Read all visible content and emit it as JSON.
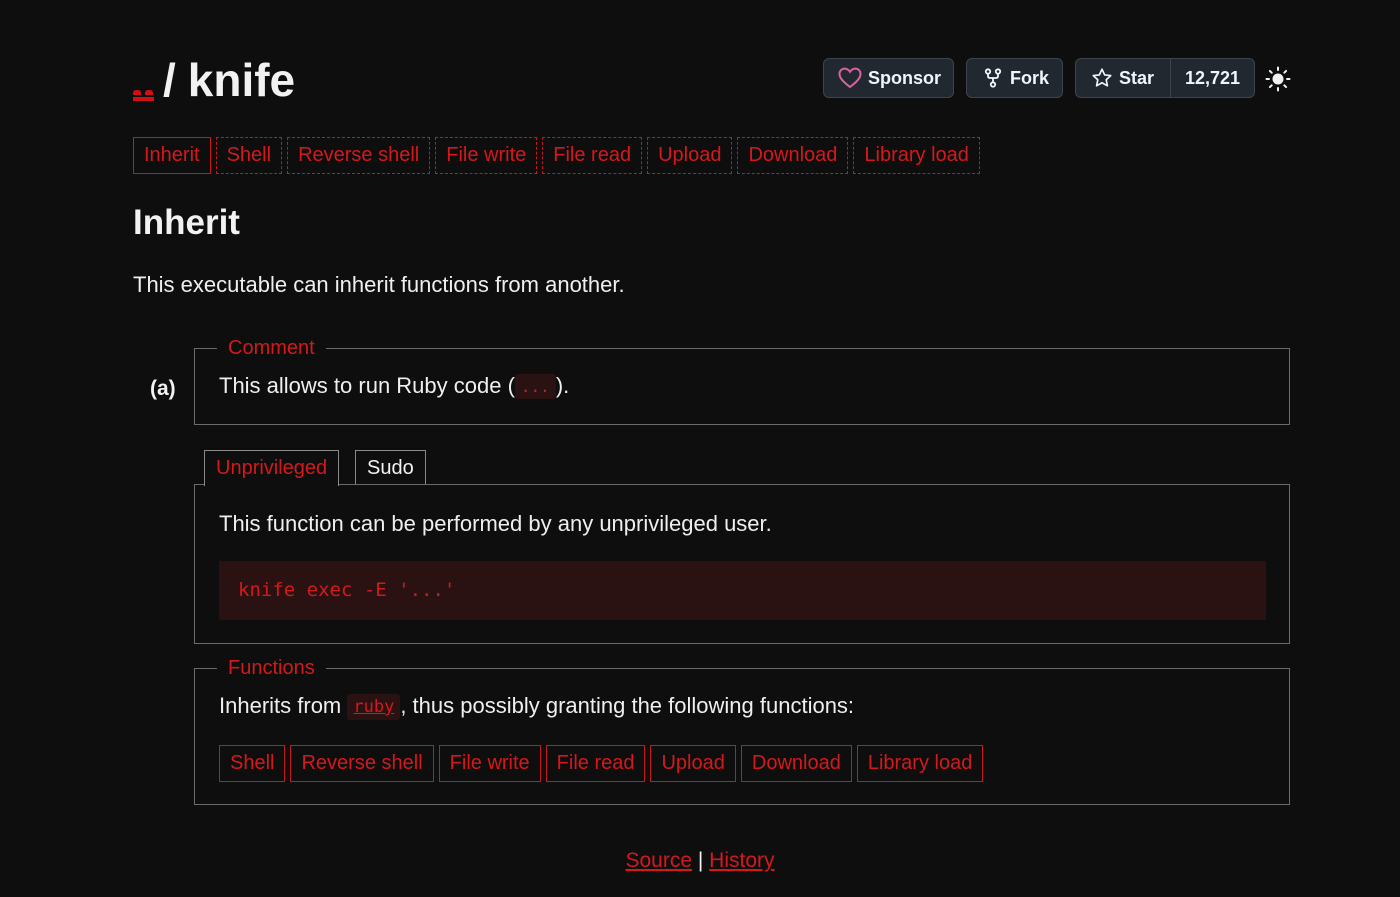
{
  "header": {
    "separator": "/",
    "name": "knife",
    "sponsor_label": "Sponsor",
    "fork_label": "Fork",
    "star_label": "Star",
    "star_count": "12,721"
  },
  "nav_tags": [
    "Inherit",
    "Shell",
    "Reverse shell",
    "File write",
    "File read",
    "Upload",
    "Download",
    "Library load"
  ],
  "section": {
    "title": "Inherit",
    "description": "This executable can inherit functions from another."
  },
  "entry": {
    "label": "(a)",
    "comment_legend": "Comment",
    "comment_text_before": "This allows to run Ruby code (",
    "comment_code": "...",
    "comment_text_after": ").",
    "tabs": [
      "Unprivileged",
      "Sudo"
    ],
    "active_tab": "Unprivileged",
    "privilege_text": "This function can be performed by any unprivileged user.",
    "command": "knife exec -E '...'",
    "functions_legend": "Functions",
    "functions_text_before": "Inherits from ",
    "functions_link": "ruby",
    "functions_text_after": ", thus possibly granting the following functions:",
    "function_tags": [
      "Shell",
      "Reverse shell",
      "File write",
      "File read",
      "Upload",
      "Download",
      "Library load"
    ]
  },
  "footer": {
    "source_label": "Source",
    "separator": "|",
    "history_label": "History"
  },
  "colors": {
    "background": "#0e0e0f",
    "accent": "#d4191c",
    "text": "#efefef",
    "code_background": "#2a1213"
  },
  "icons": {
    "sponsor": "heart-icon",
    "fork": "repo-forked-icon",
    "star": "star-icon",
    "theme": "sun-icon"
  }
}
